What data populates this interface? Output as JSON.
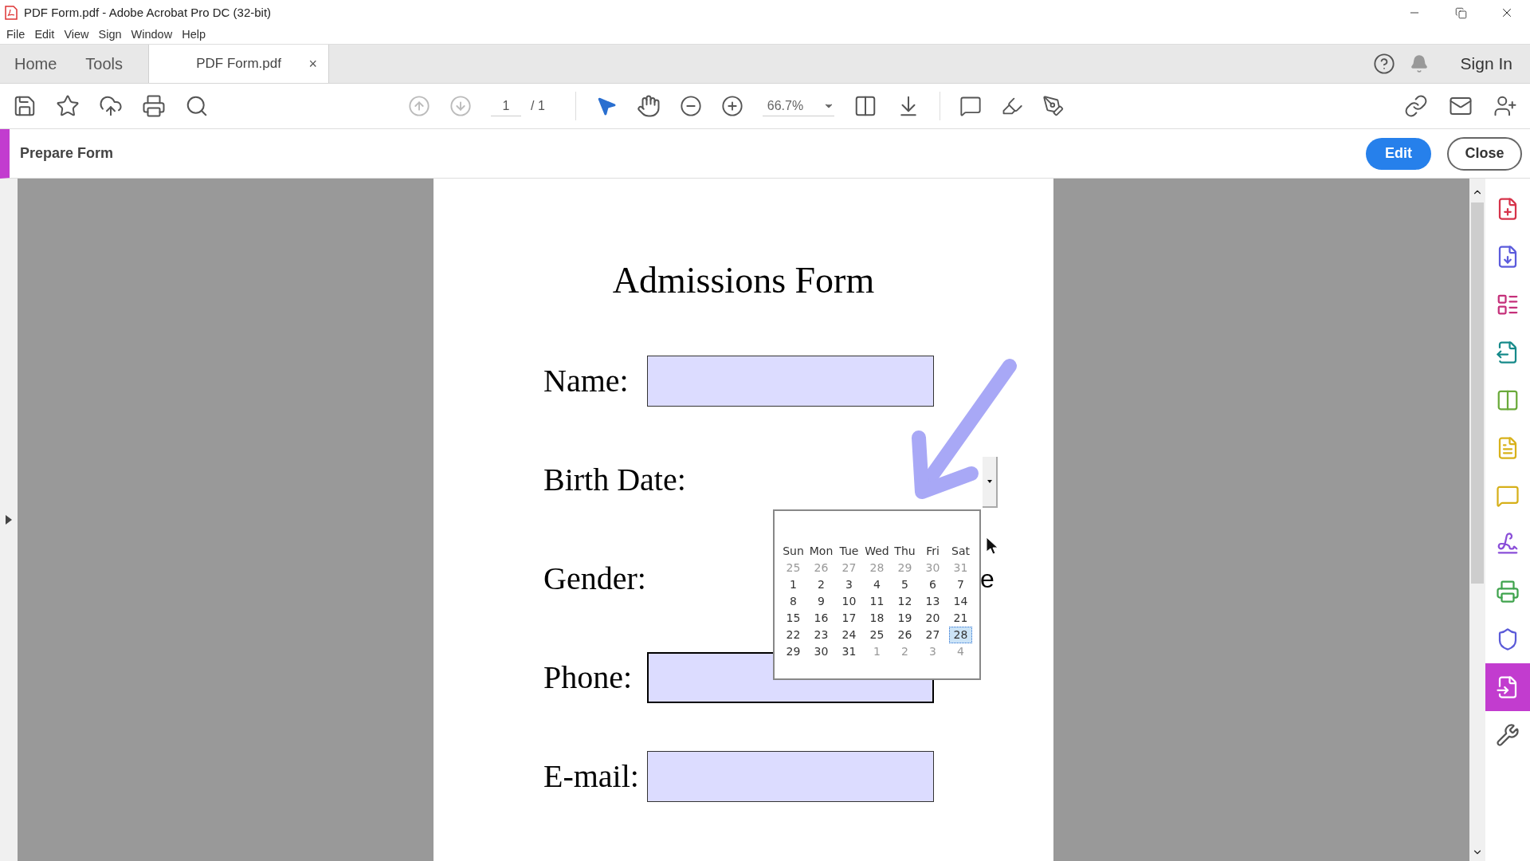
{
  "window": {
    "title": "PDF Form.pdf - Adobe Acrobat Pro DC (32-bit)"
  },
  "menu": [
    "File",
    "Edit",
    "View",
    "Sign",
    "Window",
    "Help"
  ],
  "tabs": [
    {
      "label": "Home",
      "selected": false,
      "kind": "nav"
    },
    {
      "label": "Tools",
      "selected": false,
      "kind": "nav"
    },
    {
      "label": "PDF Form.pdf",
      "selected": true,
      "kind": "document",
      "close": "×"
    }
  ],
  "account": {
    "sign_in": "Sign In"
  },
  "toolbar": {
    "page_current": "1",
    "page_total": "/ 1",
    "zoom": "66.7%"
  },
  "tool_bar": {
    "title": "Prepare Form",
    "buttons": [
      {
        "label": "Edit",
        "kind": "primary"
      },
      {
        "label": "Close",
        "kind": "secondary"
      }
    ]
  },
  "form": {
    "title": "Admissions Form",
    "rows": [
      {
        "label": "Name:",
        "kind": "field"
      },
      {
        "label": "Birth Date:",
        "kind": "date"
      },
      {
        "label": "Gender:",
        "kind": "options",
        "fragments": [
          "e"
        ]
      },
      {
        "label": "Phone:",
        "kind": "field"
      },
      {
        "label": "E-mail:",
        "kind": "field"
      }
    ]
  },
  "calendar": {
    "weekdays": [
      "Sun",
      "Mon",
      "Tue",
      "Wed",
      "Thu",
      "Fri",
      "Sat"
    ],
    "weeks": [
      [
        {
          "day": "25",
          "muted": true,
          "selected": false
        },
        {
          "day": "26",
          "muted": true,
          "selected": false
        },
        {
          "day": "27",
          "muted": true,
          "selected": false
        },
        {
          "day": "28",
          "muted": true,
          "selected": false
        },
        {
          "day": "29",
          "muted": true,
          "selected": false
        },
        {
          "day": "30",
          "muted": true,
          "selected": false
        },
        {
          "day": "31",
          "muted": true,
          "selected": false
        }
      ],
      [
        {
          "day": "1",
          "muted": false,
          "selected": false
        },
        {
          "day": "2",
          "muted": false,
          "selected": false
        },
        {
          "day": "3",
          "muted": false,
          "selected": false
        },
        {
          "day": "4",
          "muted": false,
          "selected": false
        },
        {
          "day": "5",
          "muted": false,
          "selected": false
        },
        {
          "day": "6",
          "muted": false,
          "selected": false
        },
        {
          "day": "7",
          "muted": false,
          "selected": false
        }
      ],
      [
        {
          "day": "8",
          "muted": false,
          "selected": false
        },
        {
          "day": "9",
          "muted": false,
          "selected": false
        },
        {
          "day": "10",
          "muted": false,
          "selected": false
        },
        {
          "day": "11",
          "muted": false,
          "selected": false
        },
        {
          "day": "12",
          "muted": false,
          "selected": false
        },
        {
          "day": "13",
          "muted": false,
          "selected": false
        },
        {
          "day": "14",
          "muted": false,
          "selected": false
        }
      ],
      [
        {
          "day": "15",
          "muted": false,
          "selected": false
        },
        {
          "day": "16",
          "muted": false,
          "selected": false
        },
        {
          "day": "17",
          "muted": false,
          "selected": false
        },
        {
          "day": "18",
          "muted": false,
          "selected": false
        },
        {
          "day": "19",
          "muted": false,
          "selected": false
        },
        {
          "day": "20",
          "muted": false,
          "selected": false
        },
        {
          "day": "21",
          "muted": false,
          "selected": false
        }
      ],
      [
        {
          "day": "22",
          "muted": false,
          "selected": false
        },
        {
          "day": "23",
          "muted": false,
          "selected": false
        },
        {
          "day": "24",
          "muted": false,
          "selected": false
        },
        {
          "day": "25",
          "muted": false,
          "selected": false
        },
        {
          "day": "26",
          "muted": false,
          "selected": false
        },
        {
          "day": "27",
          "muted": false,
          "selected": false
        },
        {
          "day": "28",
          "muted": false,
          "selected": true
        }
      ],
      [
        {
          "day": "29",
          "muted": false,
          "selected": false
        },
        {
          "day": "30",
          "muted": false,
          "selected": false
        },
        {
          "day": "31",
          "muted": false,
          "selected": false
        },
        {
          "day": "1",
          "muted": true,
          "selected": false
        },
        {
          "day": "2",
          "muted": true,
          "selected": false
        },
        {
          "day": "3",
          "muted": true,
          "selected": false
        },
        {
          "day": "4",
          "muted": true,
          "selected": false
        }
      ]
    ]
  },
  "right_panel": [
    {
      "kind": "create",
      "selected": false
    },
    {
      "kind": "export",
      "selected": false
    },
    {
      "kind": "organize",
      "selected": false
    },
    {
      "kind": "send",
      "selected": false
    },
    {
      "kind": "compare",
      "selected": false
    },
    {
      "kind": "fill",
      "selected": false
    },
    {
      "kind": "comment",
      "selected": false
    },
    {
      "kind": "sign",
      "selected": false
    },
    {
      "kind": "print",
      "selected": false
    },
    {
      "kind": "protect",
      "selected": false
    },
    {
      "kind": "prepare",
      "selected": true
    },
    {
      "kind": "more",
      "selected": false
    }
  ]
}
